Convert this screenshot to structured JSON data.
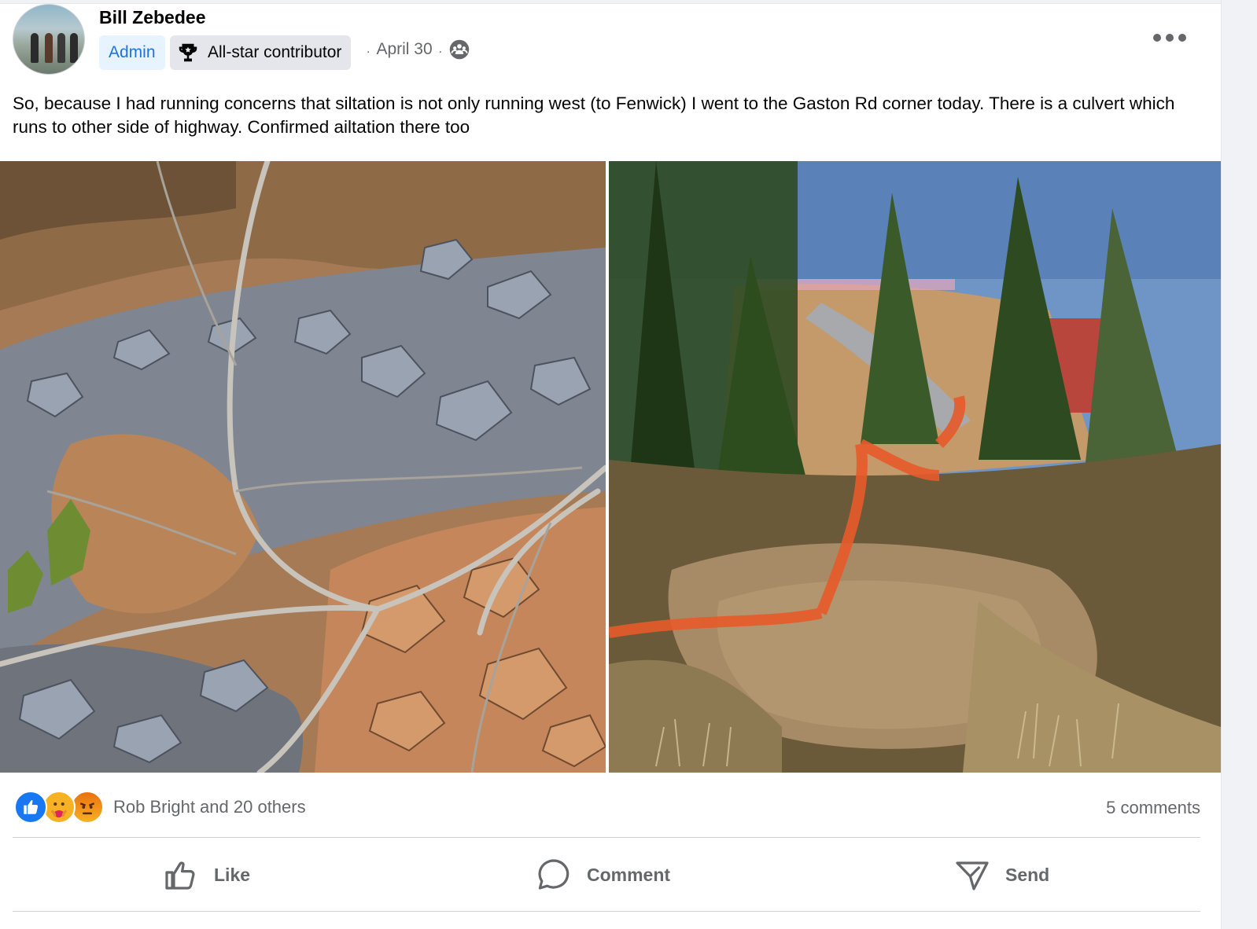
{
  "post": {
    "author": "Bill Zebedee",
    "badges": {
      "admin": "Admin",
      "contributor": "All-star contributor"
    },
    "separator": ".",
    "date": "April 30",
    "text": "So, because I had running concerns that siltation is not only running west (to Fenwick) I went to the Gaston Rd corner today. There is a culvert which runs to other side of highway. Confirmed ailtation there too"
  },
  "reactions": {
    "types": [
      "like",
      "care",
      "angry"
    ],
    "summary": "Rob Bright and 20 others",
    "comments": "5 comments"
  },
  "actions": {
    "like": "Like",
    "comment": "Comment",
    "send": "Send"
  },
  "colors": {
    "accent": "#1877f2",
    "admin_badge_bg": "#e7f3ff",
    "admin_badge_text": "#1b74e4",
    "secondary_text": "#65676b",
    "primary_text": "#050505"
  },
  "icons": {
    "options": "more-horizontal-icon",
    "audience": "group-globe-icon",
    "badge": "trophy-icon",
    "like": "thumbs-up-icon",
    "comment": "speech-bubble-icon",
    "send": "send-icon"
  }
}
